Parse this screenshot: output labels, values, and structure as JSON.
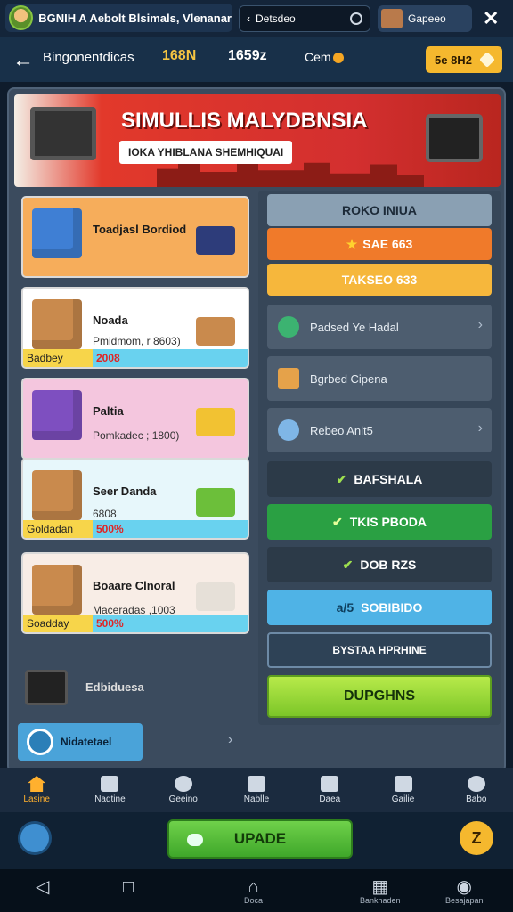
{
  "topbar": {
    "app_title": "BGNIH A Aebolt Blsimals, Vlenanard",
    "search_label": "Detsdeo",
    "profile_label": "Gapeeo",
    "close": "✕"
  },
  "navbar": {
    "back": "←",
    "title": "Bingonentdicas",
    "stat1": "168N",
    "stat2": "1659z",
    "coin_label": "Cem",
    "action_button": "5e 8H2"
  },
  "banner": {
    "title": "SIMULLIS MALYDBNSIA",
    "subtitle": "IOKA YHIBLANA SHEMHIQUAI"
  },
  "shop_items": [
    {
      "name": "Toadjasl Bordiod",
      "desc": "",
      "strip_label": "",
      "strip_value": "",
      "bg": "#f6ad5b"
    },
    {
      "name": "Noada",
      "desc": "Pmidmom, r 8603)",
      "strip_label": "Badbey",
      "strip_value": "2008",
      "bg": "#ffffff"
    },
    {
      "name": "Paltia",
      "desc": "Pomkadec ; 1800)",
      "strip_label": "",
      "strip_value": "",
      "bg": "#f4c6de"
    },
    {
      "name": "Seer Danda",
      "desc": "6808",
      "strip_label": "Goldadan",
      "strip_value": "500%",
      "bg": "#e7f7fb"
    },
    {
      "name": "Boaare Clnoral",
      "desc": "Maceradas ,1003",
      "strip_label": "Soadday",
      "strip_value": "500%",
      "bg": "#f8ede6"
    }
  ],
  "tv_item": {
    "label": "Edbiduesa"
  },
  "network": {
    "label": "Nidatetael",
    "chevron": "›"
  },
  "right_panel": {
    "header": "ROKO INIUA",
    "orange_btn": "SAE 663",
    "orange_star": "★",
    "yellow_btn": "TAKSEO 633",
    "list_items": [
      {
        "label": "Padsed Ye Hadal",
        "chevron": "›",
        "icon_color": "#3cb371"
      },
      {
        "label": "Bgrbed Cipena",
        "chevron": "",
        "icon_color": "#e5a24a"
      },
      {
        "label": "Rebeo Anlt5",
        "chevron": "›",
        "icon_color": "#7fb6e6"
      }
    ],
    "check": "✔",
    "btn_dark": "BAFSHALA",
    "btn_green": "TKIS PBODA",
    "btn_dark2": "DOB RZS",
    "btn_blue_prefix": "a/5",
    "btn_blue": "SOBIBIDO",
    "btn_outline": "BYSTAA HPRHINE",
    "btn_lime": "DUPGHNS"
  },
  "tabs": [
    {
      "label": "Lasine",
      "active": true
    },
    {
      "label": "Nadtine",
      "active": false
    },
    {
      "label": "Geeino",
      "active": false
    },
    {
      "label": "Nablle",
      "active": false
    },
    {
      "label": "Daea",
      "active": false
    },
    {
      "label": "Gailie",
      "active": false
    },
    {
      "label": "Babo",
      "active": false
    }
  ],
  "action": {
    "main": "UPADE",
    "right": "Z"
  },
  "system": {
    "nav_back": "◁",
    "nav_square": "□",
    "home_label": "Doca",
    "store_label": "Bankhaden",
    "account_label": "Besajapan"
  }
}
